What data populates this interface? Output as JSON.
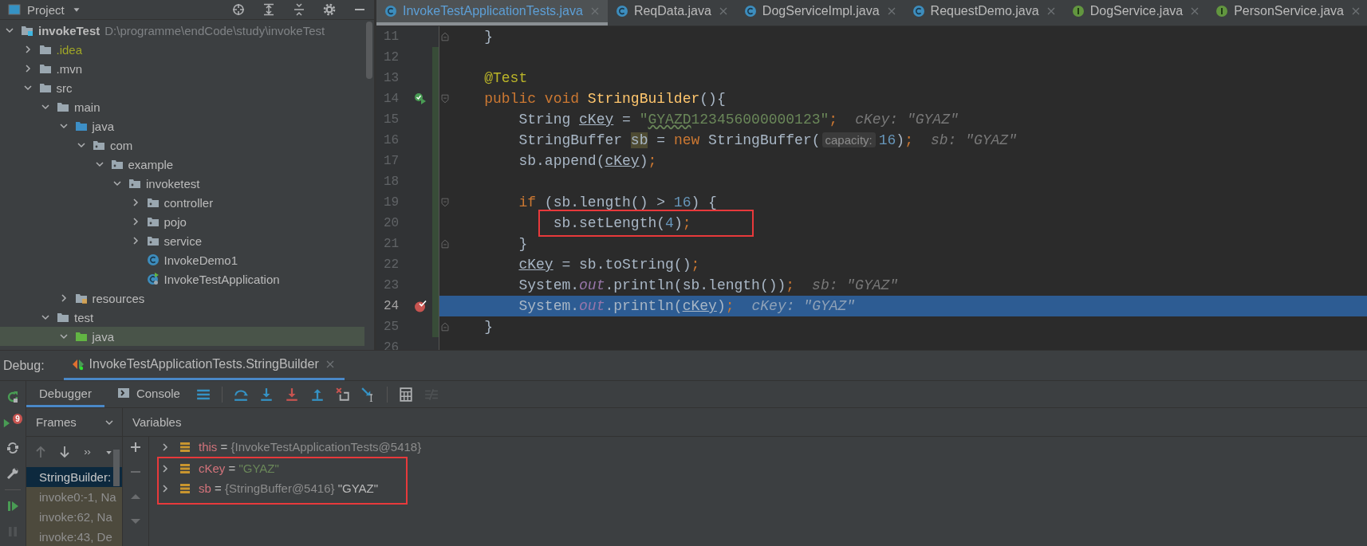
{
  "project_panel": {
    "title": "Project",
    "tree": [
      {
        "label": "invokeTest",
        "path": "D:\\programme\\endCode\\study\\invokeTest",
        "kind": "module",
        "expanded": true,
        "selected": false,
        "children": [
          {
            "label": ".idea",
            "kind": "folder",
            "ignored": true,
            "expanded": false,
            "selected": false
          },
          {
            "label": ".mvn",
            "kind": "folder",
            "expanded": false,
            "selected": false
          },
          {
            "label": "src",
            "kind": "folder",
            "expanded": true,
            "selected": false,
            "children": [
              {
                "label": "main",
                "kind": "folder",
                "expanded": true,
                "selected": false,
                "children": [
                  {
                    "label": "java",
                    "kind": "source",
                    "expanded": true,
                    "selected": false,
                    "children": [
                      {
                        "label": "com",
                        "kind": "package",
                        "expanded": true,
                        "selected": false,
                        "children": [
                          {
                            "label": "example",
                            "kind": "package",
                            "expanded": true,
                            "selected": false,
                            "children": [
                              {
                                "label": "invoketest",
                                "kind": "package",
                                "expanded": true,
                                "selected": false,
                                "children": [
                                  {
                                    "label": "controller",
                                    "kind": "package",
                                    "expanded": false,
                                    "selected": false
                                  },
                                  {
                                    "label": "pojo",
                                    "kind": "package",
                                    "expanded": false,
                                    "selected": false
                                  },
                                  {
                                    "label": "service",
                                    "kind": "package",
                                    "expanded": false,
                                    "selected": false
                                  },
                                  {
                                    "label": "InvokeDemo1",
                                    "kind": "class",
                                    "selected": false
                                  },
                                  {
                                    "label": "InvokeTestApplication",
                                    "kind": "application",
                                    "selected": false
                                  }
                                ]
                              }
                            ]
                          }
                        ]
                      }
                    ]
                  },
                  {
                    "label": "resources",
                    "kind": "resources",
                    "expanded": false,
                    "selected": false
                  }
                ]
              },
              {
                "label": "test",
                "kind": "folder",
                "expanded": true,
                "selected": false,
                "children": [
                  {
                    "label": "java",
                    "kind": "tests",
                    "expanded": true,
                    "selected": true
                  }
                ]
              }
            ]
          }
        ]
      }
    ]
  },
  "editor": {
    "tabs": [
      {
        "label": "InvokeTestApplicationTests.java",
        "kind": "class",
        "selected": true
      },
      {
        "label": "ReqData.java",
        "kind": "class",
        "selected": false
      },
      {
        "label": "DogServiceImpl.java",
        "kind": "class",
        "selected": false
      },
      {
        "label": "RequestDemo.java",
        "kind": "class",
        "selected": false
      },
      {
        "label": "DogService.java",
        "kind": "interface",
        "selected": false
      },
      {
        "label": "PersonService.java",
        "kind": "interface",
        "selected": false
      }
    ],
    "lines": [
      {
        "number": "11",
        "fold_marker": {
          "kind": "end"
        },
        "changed": false,
        "current": false,
        "boxed": false,
        "tokens": [
          {
            "text": "    }",
            "kind": "plain"
          }
        ]
      },
      {
        "number": "12",
        "changed": true,
        "current": false,
        "boxed": false
      },
      {
        "number": "13",
        "changed": true,
        "current": false,
        "boxed": false,
        "tokens": [
          {
            "text": "    @Test",
            "kind": "annotation"
          }
        ]
      },
      {
        "number": "14",
        "gutter_icon": {
          "kind": "run"
        },
        "fold_marker": {
          "kind": "start"
        },
        "changed": true,
        "current": false,
        "boxed": false,
        "tokens": [
          {
            "text": "    public void ",
            "kind": "keyword"
          },
          {
            "text": "StringBuilder",
            "kind": "method"
          },
          {
            "text": "(){",
            "kind": "plain"
          }
        ]
      },
      {
        "number": "15",
        "changed": true,
        "current": false,
        "boxed": false,
        "tokens": [
          {
            "text": "        String ",
            "kind": "plain"
          },
          {
            "text": "cKey",
            "kind": "var"
          },
          {
            "text": " = ",
            "kind": "plain"
          },
          {
            "text": "\"",
            "kind": "string"
          },
          {
            "text": "GYAZD",
            "kind": "string-typo"
          },
          {
            "text": "123456000000123\"",
            "kind": "string"
          },
          {
            "text": ";",
            "kind": "punct"
          },
          {
            "text": "cKey: \"GYAZ\"",
            "kind": "inline-value"
          }
        ]
      },
      {
        "number": "16",
        "changed": true,
        "current": false,
        "boxed": false,
        "tokens": [
          {
            "text": "        StringBuffer ",
            "kind": "plain"
          },
          {
            "text": "sb",
            "kind": "var-highlight"
          },
          {
            "text": " = ",
            "kind": "plain"
          },
          {
            "text": "new",
            "kind": "keyword"
          },
          {
            "text": " StringBuffer(",
            "kind": "plain"
          },
          {
            "text": "capacity:",
            "kind": "param-hint"
          },
          {
            "text": "16",
            "kind": "number"
          },
          {
            "text": ")",
            "kind": "plain"
          },
          {
            "text": ";",
            "kind": "punct"
          },
          {
            "text": "sb: \"GYAZ\"",
            "kind": "inline-value"
          }
        ]
      },
      {
        "number": "17",
        "changed": true,
        "current": false,
        "boxed": false,
        "tokens": [
          {
            "text": "        sb.append(",
            "kind": "plain"
          },
          {
            "text": "cKey",
            "kind": "var"
          },
          {
            "text": ")",
            "kind": "plain"
          },
          {
            "text": ";",
            "kind": "punct"
          }
        ]
      },
      {
        "number": "18",
        "changed": true,
        "current": false,
        "boxed": false
      },
      {
        "number": "19",
        "fold_marker": {
          "kind": "start"
        },
        "changed": true,
        "current": false,
        "boxed": false,
        "tokens": [
          {
            "text": "        if",
            "kind": "keyword"
          },
          {
            "text": " (sb.length() > ",
            "kind": "plain"
          },
          {
            "text": "16",
            "kind": "number"
          },
          {
            "text": ") {",
            "kind": "plain"
          }
        ]
      },
      {
        "number": "20",
        "changed": true,
        "current": false,
        "boxed": true,
        "tokens": [
          {
            "text": "            sb.setLength(",
            "kind": "plain"
          },
          {
            "text": "4",
            "kind": "number"
          },
          {
            "text": ")",
            "kind": "plain"
          },
          {
            "text": ";",
            "kind": "punct"
          }
        ]
      },
      {
        "number": "21",
        "fold_marker": {
          "kind": "end"
        },
        "changed": true,
        "current": false,
        "boxed": false,
        "tokens": [
          {
            "text": "        }",
            "kind": "plain"
          }
        ]
      },
      {
        "number": "22",
        "changed": true,
        "current": false,
        "boxed": false,
        "tokens": [
          {
            "text": "        cKey",
            "kind": "var"
          },
          {
            "text": " = sb.toString()",
            "kind": "plain"
          },
          {
            "text": ";",
            "kind": "punct"
          }
        ]
      },
      {
        "number": "23",
        "changed": true,
        "current": false,
        "boxed": false,
        "tokens": [
          {
            "text": "        System.",
            "kind": "plain"
          },
          {
            "text": "out",
            "kind": "static-field"
          },
          {
            "text": ".println(sb.length())",
            "kind": "plain"
          },
          {
            "text": ";",
            "kind": "punct"
          },
          {
            "text": "sb: \"GYAZ\"",
            "kind": "inline-value"
          }
        ]
      },
      {
        "number": "24",
        "gutter_icon": {
          "kind": "breakpoint"
        },
        "changed": true,
        "current": true,
        "boxed": false,
        "tokens": [
          {
            "text": "        System.",
            "kind": "plain"
          },
          {
            "text": "out",
            "kind": "static-field"
          },
          {
            "text": ".println(",
            "kind": "plain"
          },
          {
            "text": "cKey",
            "kind": "var"
          },
          {
            "text": ")",
            "kind": "plain"
          },
          {
            "text": ";",
            "kind": "punct"
          },
          {
            "text": "cKey: \"GYAZ\"",
            "kind": "inline-value"
          }
        ]
      },
      {
        "number": "25",
        "fold_marker": {
          "kind": "end"
        },
        "changed": true,
        "current": false,
        "boxed": false,
        "tokens": [
          {
            "text": "    }",
            "kind": "plain"
          }
        ]
      },
      {
        "number": "26",
        "changed": false,
        "current": false,
        "boxed": false
      }
    ]
  },
  "debug": {
    "label": "Debug:",
    "session_tab": {
      "label": "InvokeTestApplicationTests.StringBuilder",
      "selected": true
    },
    "side_tools": [
      {
        "kind": "rerun",
        "disabled": false
      },
      {
        "kind": "run-tests",
        "badge": "9",
        "disabled": false
      },
      {
        "kind": "refresh",
        "disabled": false
      },
      {
        "kind": "wrench",
        "disabled": false
      },
      {
        "kind": "resume",
        "disabled": false
      },
      {
        "kind": "pause",
        "disabled": true
      }
    ],
    "tabs": [
      {
        "label": "Debugger",
        "selected": true
      },
      {
        "label": "Console",
        "kind": "console",
        "selected": false
      }
    ],
    "toolbar": [
      {
        "kind": "list",
        "disabled": false
      },
      {
        "kind": "step-over",
        "disabled": false
      },
      {
        "kind": "step-into",
        "disabled": false
      },
      {
        "kind": "force-step-into",
        "disabled": false
      },
      {
        "kind": "step-out",
        "disabled": false
      },
      {
        "kind": "drop-frame",
        "disabled": false
      },
      {
        "kind": "run-to-cursor",
        "disabled": false
      },
      {
        "kind": "calculator",
        "disabled": false
      },
      {
        "kind": "trace",
        "disabled": true
      }
    ],
    "frames": {
      "title": "Frames",
      "tools": [
        {
          "kind": "arrow-up",
          "disabled": true
        },
        {
          "kind": "arrow-down",
          "disabled": false
        },
        {
          "kind": "more",
          "disabled": false
        },
        {
          "kind": "caret",
          "disabled": false
        }
      ],
      "items": [
        {
          "label": "StringBuilder:",
          "selected": true,
          "library": false
        },
        {
          "label": "invoke0:-1, Na",
          "selected": false,
          "library": true
        },
        {
          "label": "invoke:62, Na",
          "selected": false,
          "library": true
        },
        {
          "label": "invoke:43, De",
          "selected": false,
          "library": true
        }
      ]
    },
    "variables": {
      "title": "Variables",
      "tools": [
        {
          "kind": "plus",
          "disabled": false
        },
        {
          "kind": "minus",
          "disabled": true
        },
        {
          "kind": "tri-up",
          "disabled": true
        },
        {
          "kind": "tri-down",
          "disabled": true
        }
      ],
      "items": [
        {
          "name": "this",
          "op": "=",
          "ref": "{InvokeTestApplicationTests@5418}",
          "expandable": true,
          "boxed": false
        },
        {
          "name": "cKey",
          "op": "=",
          "value": "\"GYAZ\"",
          "kind": "string",
          "expandable": true,
          "boxed": true
        },
        {
          "name": "sb",
          "op": "=",
          "ref": "{StringBuffer@5416}",
          "value": "\"GYAZ\"",
          "kind": "object",
          "expandable": true,
          "boxed": true
        }
      ]
    }
  }
}
